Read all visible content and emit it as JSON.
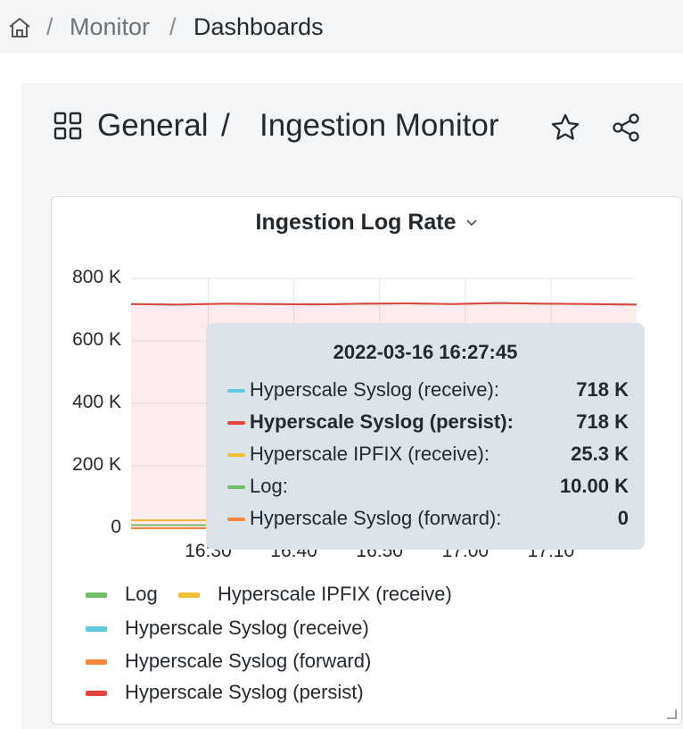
{
  "breadcrumb": {
    "home_icon": "home-icon",
    "separator": "/",
    "items": [
      "Monitor",
      "Dashboards"
    ]
  },
  "dashboard": {
    "folder": "General",
    "separator": "/",
    "title": "Ingestion Monitor",
    "icons": [
      "dashboard-grid-icon",
      "star-icon",
      "share-icon"
    ]
  },
  "panel": {
    "title": "Ingestion Log Rate",
    "menu_icon": "chevron-down-icon"
  },
  "chart_data": {
    "type": "line",
    "y_ticks": [
      "800 K",
      "600 K",
      "400 K",
      "200 K",
      "0"
    ],
    "ylim": [
      0,
      800000
    ],
    "x_ticks": [
      "16:30",
      "16:40",
      "16:50",
      "17:00",
      "17:10"
    ],
    "xlim": [
      "16:21",
      "17:20"
    ],
    "grid": true,
    "series": [
      {
        "name": "Log",
        "color": "#73bf69",
        "values": [
          10000,
          10000,
          10000,
          10000,
          10000,
          10000,
          10000,
          10000,
          10000,
          10000,
          10000,
          10000
        ]
      },
      {
        "name": "Hyperscale IPFIX (receive)",
        "color": "#f2c037",
        "values": [
          25300,
          25300,
          25300,
          25300,
          25300,
          25300,
          25300,
          25300,
          25300,
          25300,
          25300,
          25300
        ]
      },
      {
        "name": "Hyperscale Syslog (receive)",
        "color": "#5ecbe0",
        "values": [
          718000,
          716000,
          719000,
          718000,
          717000,
          719000,
          720000,
          718000,
          721000,
          719000,
          718000,
          716000
        ]
      },
      {
        "name": "Hyperscale Syslog (forward)",
        "color": "#f5873a",
        "values": [
          0,
          0,
          0,
          0,
          0,
          0,
          0,
          0,
          0,
          0,
          0,
          0
        ]
      },
      {
        "name": "Hyperscale Syslog (persist)",
        "color": "#e0443c",
        "values": [
          718000,
          716000,
          719000,
          718000,
          717000,
          719000,
          720000,
          718000,
          721000,
          719000,
          718000,
          716000
        ]
      }
    ]
  },
  "tooltip": {
    "time": "2022-03-16 16:27:45",
    "rows": [
      {
        "name": "Hyperscale Syslog (receive):",
        "value": "718 K",
        "color": "#5ecbe0"
      },
      {
        "name": "Hyperscale Syslog (persist):",
        "value": "718 K",
        "color": "#e0443c"
      },
      {
        "name": "Hyperscale IPFIX (receive):",
        "value": "25.3 K",
        "color": "#f2c037"
      },
      {
        "name": "Log:",
        "value": "10.00 K",
        "color": "#73bf69"
      },
      {
        "name": "Hyperscale Syslog (forward):",
        "value": "0",
        "color": "#f5873a"
      }
    ]
  },
  "legend": {
    "items": [
      {
        "name": "Log",
        "color": "#73bf69"
      },
      {
        "name": "Hyperscale IPFIX (receive)",
        "color": "#f2c037"
      },
      {
        "name": "Hyperscale Syslog (receive)",
        "color": "#5ecbe0"
      },
      {
        "name": "Hyperscale Syslog (forward)",
        "color": "#f5873a"
      },
      {
        "name": "Hyperscale Syslog (persist)",
        "color": "#e0443c"
      }
    ]
  }
}
